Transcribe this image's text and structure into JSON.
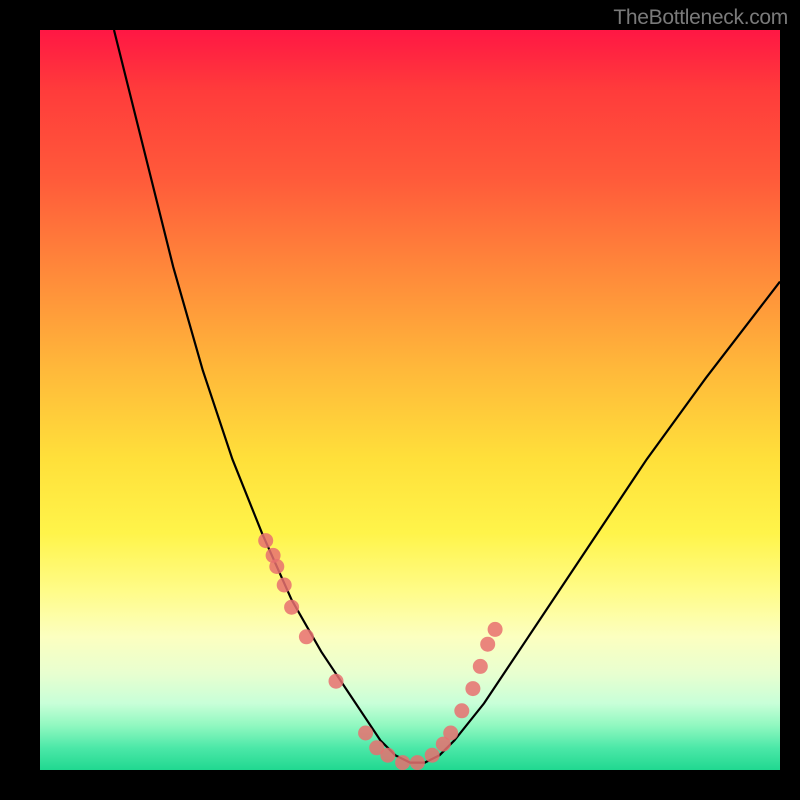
{
  "watermark": "TheBottleneck.com",
  "chart_data": {
    "type": "line",
    "title": "",
    "xlabel": "",
    "ylabel": "",
    "xlim": [
      0,
      100
    ],
    "ylim": [
      0,
      100
    ],
    "series": [
      {
        "name": "curve",
        "x": [
          10,
          14,
          18,
          22,
          26,
          30,
          34,
          38,
          40,
          42,
          44,
          46,
          48,
          50,
          52,
          54,
          56,
          60,
          66,
          74,
          82,
          90,
          100
        ],
        "y": [
          100,
          84,
          68,
          54,
          42,
          32,
          23,
          16,
          13,
          10,
          7,
          4,
          2,
          1,
          1,
          2,
          4,
          9,
          18,
          30,
          42,
          53,
          66
        ]
      }
    ],
    "markers": {
      "name": "data-points",
      "x": [
        30.5,
        31.5,
        32,
        33,
        34,
        36,
        40,
        44,
        45.5,
        47,
        49,
        51,
        53,
        54.5,
        55.5,
        57,
        58.5,
        59.5,
        60.5,
        61.5
      ],
      "y": [
        31,
        29,
        27.5,
        25,
        22,
        18,
        12,
        5,
        3,
        2,
        1,
        1,
        2,
        3.5,
        5,
        8,
        11,
        14,
        17,
        19
      ]
    },
    "gradient_stops": [
      {
        "pos": 0,
        "color": "#ff1744"
      },
      {
        "pos": 50,
        "color": "#ffe03a"
      },
      {
        "pos": 100,
        "color": "#20d890"
      }
    ]
  }
}
